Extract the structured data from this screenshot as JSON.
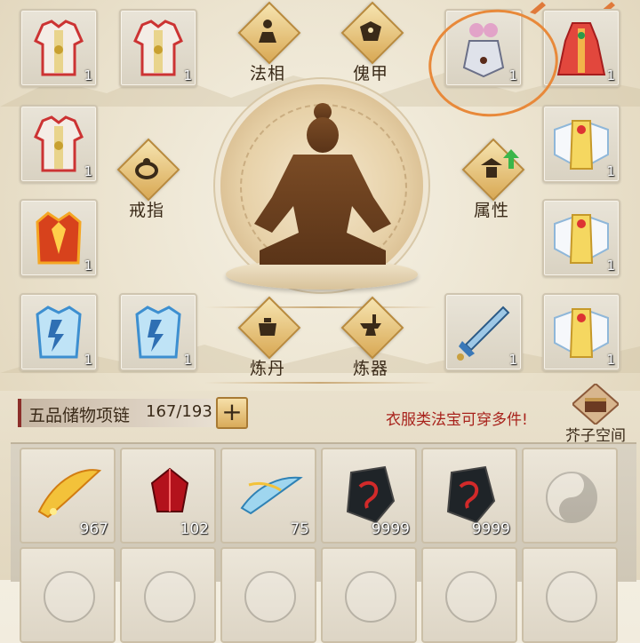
{
  "equipment": {
    "left_slots": [
      {
        "id": "robe-1",
        "count": "1",
        "icon": "white-red-robe"
      },
      {
        "id": "robe-2",
        "count": "1",
        "icon": "white-red-robe"
      },
      {
        "id": "robe-3",
        "count": "1",
        "icon": "white-red-robe"
      },
      {
        "id": "fire-armor",
        "count": "1",
        "icon": "flame-armor"
      },
      {
        "id": "ice-armor-1",
        "count": "1",
        "icon": "lightning-armor"
      },
      {
        "id": "ice-armor-2",
        "count": "1",
        "icon": "lightning-armor"
      }
    ],
    "right_slots": [
      {
        "id": "lotus-crown",
        "count": "1",
        "icon": "lotus-crown"
      },
      {
        "id": "red-dress",
        "count": "1",
        "icon": "red-dress"
      },
      {
        "id": "winged-robe-1",
        "count": "1",
        "icon": "winged-robe"
      },
      {
        "id": "winged-robe-2",
        "count": "1",
        "icon": "winged-robe"
      },
      {
        "id": "blue-sword",
        "count": "1",
        "icon": "sword"
      },
      {
        "id": "winged-robe-3",
        "count": "1",
        "icon": "winged-robe"
      }
    ],
    "functions": {
      "faxiang": "法相",
      "kuijia": "傀甲",
      "jiezhi": "戒指",
      "shuxing": "属性",
      "liandan": "炼丹",
      "lianqi": "炼器"
    }
  },
  "bag": {
    "title": "五品储物项链",
    "capacity": "167/193",
    "add_label": "+",
    "hint": "衣服类法宝可穿多件!",
    "space_label": "芥子空间",
    "items": [
      {
        "icon": "golden-feather",
        "count": "967"
      },
      {
        "icon": "red-crystal",
        "count": "102"
      },
      {
        "icon": "blue-wind-feather",
        "count": "75"
      },
      {
        "icon": "dark-rune-stone",
        "count": "9999"
      },
      {
        "icon": "dark-rune-stone",
        "count": "9999"
      },
      {
        "icon": "empty",
        "count": ""
      }
    ]
  },
  "colors": {
    "accent": "#d9a955",
    "hint": "#a8231c",
    "highlight": "#e8893a"
  }
}
